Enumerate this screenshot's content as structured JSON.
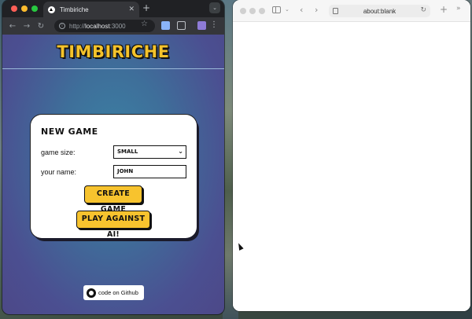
{
  "chrome": {
    "tab_title": "Timbiriche",
    "tab_close": "✕",
    "new_tab": "+",
    "tab_menu": "⌄",
    "url_prefix": "http://",
    "url_host": "localhost",
    "url_port": ":3000"
  },
  "app": {
    "logo": "TIMBIRICHE",
    "card_title": "NEW GAME",
    "game_size_label": "game size:",
    "game_size_value": "SMALL",
    "name_label": "your name:",
    "name_value": "JOHN",
    "create_button": "CREATE GAME",
    "ai_button": "PLAY AGAINST AI!",
    "github_link": "code on Github"
  },
  "safari": {
    "address": "about:blank"
  },
  "colors": {
    "accent_yellow": "#f7c32e",
    "page_blue": "#3e6f9a",
    "page_purple": "#4c4888"
  }
}
